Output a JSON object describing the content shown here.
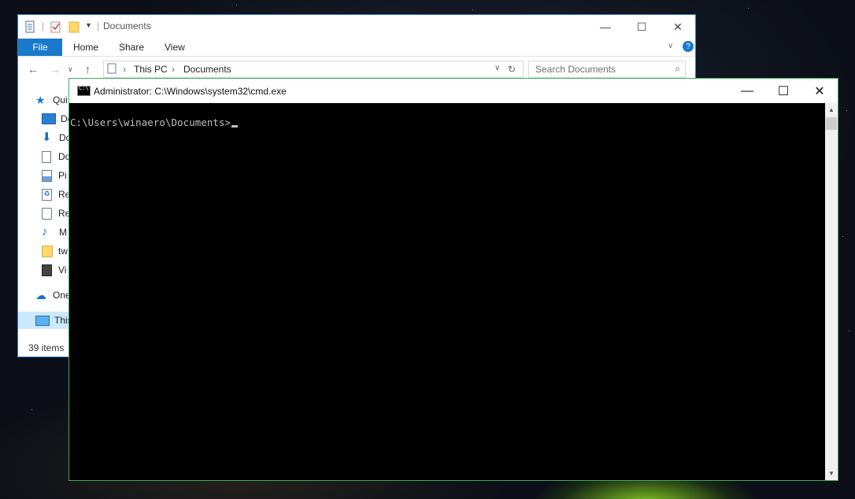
{
  "explorer": {
    "title": "Documents",
    "tabs": {
      "file": "File",
      "home": "Home",
      "share": "Share",
      "view": "View"
    },
    "address": {
      "crumb1": "This PC",
      "crumb2": "Documents"
    },
    "search_placeholder": "Search Documents",
    "sidebar": [
      "Qui",
      "De",
      "Do",
      "Do",
      "Pi",
      "Re",
      "Re",
      "M",
      "tw",
      "Vi",
      "One",
      "This"
    ],
    "status": "39 items"
  },
  "cmd": {
    "title": "Administrator: C:\\Windows\\system32\\cmd.exe",
    "prompt": "C:\\Users\\winaero\\Documents>"
  },
  "colors": {
    "accent": "#1979ca",
    "cmd_border": "#3fae5c",
    "console_bg": "#000000",
    "console_text": "#c0c0c0"
  }
}
